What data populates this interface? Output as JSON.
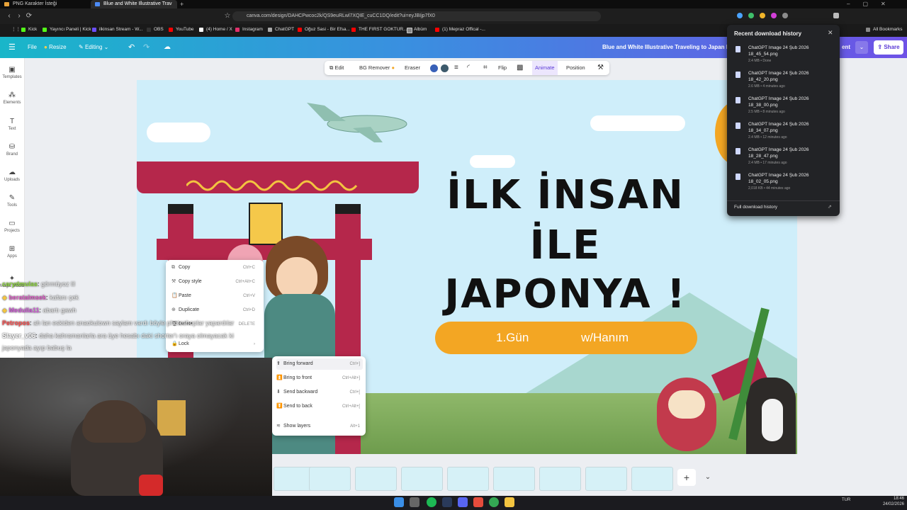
{
  "browser": {
    "tabs": [
      {
        "title": "PNG Karakter İsteği",
        "active": false
      },
      {
        "title": "Blue and White Illustrative Trav",
        "active": true
      }
    ],
    "url": "canva.com/design/DAHCPwcoc2k/QS9euRLwl7XQIE_cuCC1DQ/edit?ui=eyJBIjp7fX0",
    "bookmarks": [
      "Kick",
      "Yayıncı Paneli | Kick",
      "ilkinsan Stream - W...",
      "OBS",
      "YouTube",
      "(4) Home / X",
      "Instagram",
      "ChatGPT",
      "Oğuz Sasi - Bir Efsa...",
      "THE FIRST GOKTUR...",
      "Albüm",
      "(1) Mepraz Offical -..."
    ],
    "all_bookmarks": "All Bookmarks"
  },
  "canva_header": {
    "file": "File",
    "resize": "Resize",
    "editing": "Editing",
    "doc_title": "Blue and White Illustrative Traveling to Japan Prese",
    "present_partial": "ent",
    "share": "Share"
  },
  "sidebar": [
    {
      "label": "Templates",
      "icon": "templates-icon"
    },
    {
      "label": "Elements",
      "icon": "elements-icon"
    },
    {
      "label": "Text",
      "icon": "text-icon"
    },
    {
      "label": "Brand",
      "icon": "brand-icon"
    },
    {
      "label": "Uploads",
      "icon": "uploads-icon"
    },
    {
      "label": "Tools",
      "icon": "tools-icon"
    },
    {
      "label": "Projects",
      "icon": "projects-icon"
    },
    {
      "label": "Apps",
      "icon": "apps-icon"
    },
    {
      "label": "Magic Media",
      "icon": "magic-media-icon"
    }
  ],
  "toolbar": {
    "edit": "Edit",
    "bg_remover": "BG Remover",
    "eraser": "Eraser",
    "flip": "Flip",
    "animate": "Animate",
    "position": "Position"
  },
  "slide": {
    "line1": "İLK İNSAN",
    "line2": "İLE",
    "line3": "JAPONYA !",
    "day": "1.Gün",
    "with": "w/Hanım"
  },
  "context_menu": {
    "items": [
      {
        "label": "Copy",
        "shortcut": "Ctrl+C"
      },
      {
        "label": "Copy style",
        "shortcut": "Ctrl+Alt+C"
      },
      {
        "label": "Paste",
        "shortcut": "Ctrl+V"
      },
      {
        "label": "Duplicate",
        "shortcut": "Ctrl+D"
      },
      {
        "label": "Delete",
        "shortcut": "DELETE"
      },
      {
        "label": "Lock",
        "shortcut": ""
      }
    ]
  },
  "layer_menu": {
    "items": [
      {
        "label": "Bring forward",
        "shortcut": "Ctrl+]"
      },
      {
        "label": "Bring to front",
        "shortcut": "Ctrl+Alt+]"
      },
      {
        "label": "Send backward",
        "shortcut": "Ctrl+["
      },
      {
        "label": "Send to back",
        "shortcut": "Ctrl+Alt+["
      },
      {
        "label": "Show layers",
        "shortcut": "Alt+1"
      }
    ]
  },
  "chat": [
    {
      "user": "carydmulas",
      "msg": "görmüyoz lil",
      "color": "#8fdc3a"
    },
    {
      "user": "beratalmsek",
      "msg": "kafanı çek",
      "color": "#e05cc8"
    },
    {
      "user": "Medulla11",
      "msg": "abartı gawh",
      "color": "#d25bd9"
    },
    {
      "user": "Petropos",
      "msg": "ah lan eskiden anaokulown saylam vardı böyle photoshoplar yapardılar",
      "color": "#ff4a4a"
    },
    {
      "user": "Slayer_v06",
      "msg": "daha kahramanlarla ara üye hesabı daki shorter'ı oraya olmayacak ki",
      "color": "#ffffff"
    },
    {
      "user": "",
      "msg": "japonyada ayıp babuş la",
      "color": "#ffffff"
    }
  ],
  "downloads": {
    "title": "Recent download history",
    "items": [
      {
        "name": "ChatGPT Image 24 Şub 2026 18_45_54.png",
        "status": "2.4 MB • Done"
      },
      {
        "name": "ChatGPT Image 24 Şub 2026 18_42_20.png",
        "status": "2.6 MB • 4 minutes ago"
      },
      {
        "name": "ChatGPT Image 24 Şub 2026 18_38_00.png",
        "status": "2.5 MB • 8 minutes ago"
      },
      {
        "name": "ChatGPT Image 24 Şub 2026 18_34_07.png",
        "status": "2.4 MB • 12 minutes ago"
      },
      {
        "name": "ChatGPT Image 24 Şub 2026 18_28_47.png",
        "status": "2.4 MB • 17 minutes ago"
      },
      {
        "name": "ChatGPT Image 24 Şub 2026 18_02_05.png",
        "status": "2,018 KB • 44 minutes ago"
      }
    ],
    "full_history": "Full download history"
  },
  "taskbar": {
    "lang": "TUR",
    "time": "18:46",
    "date": "24/02/2026"
  }
}
